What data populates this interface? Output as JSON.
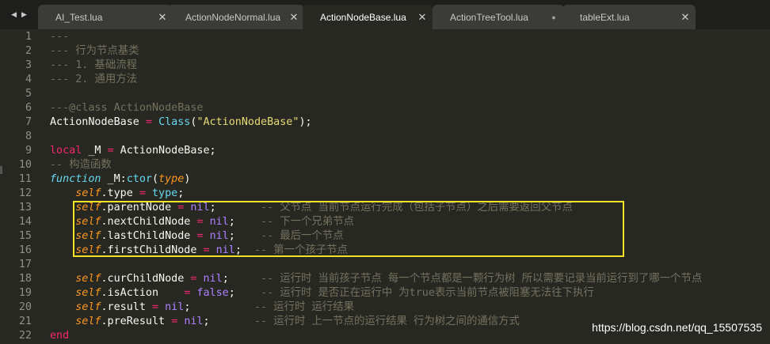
{
  "tabs": [
    {
      "label": "AI_Test.lua",
      "state": "close"
    },
    {
      "label": "ActionNodeNormal.lua",
      "state": "close"
    },
    {
      "label": "ActionNodeBase.lua",
      "state": "close",
      "active": true
    },
    {
      "label": "ActionTreeTool.lua",
      "state": "dirty"
    },
    {
      "label": "tableExt.lua",
      "state": "close"
    }
  ],
  "nav": {
    "back": "◀",
    "forward": "▶"
  },
  "lines": [
    {
      "n": "1",
      "parts": [
        [
          "cmt",
          "---"
        ]
      ]
    },
    {
      "n": "2",
      "parts": [
        [
          "cmt",
          "--- 行为节点基类"
        ]
      ]
    },
    {
      "n": "3",
      "parts": [
        [
          "cmt",
          "--- 1. 基础流程"
        ]
      ]
    },
    {
      "n": "4",
      "parts": [
        [
          "cmt",
          "--- 2. 通用方法"
        ]
      ]
    },
    {
      "n": "5",
      "parts": []
    },
    {
      "n": "6",
      "parts": [
        [
          "cmt",
          "---@class ActionNodeBase"
        ]
      ]
    },
    {
      "n": "7",
      "parts": [
        [
          "",
          "ActionNodeBase "
        ],
        [
          "op",
          "="
        ],
        [
          "",
          " "
        ],
        [
          "fn",
          "Class"
        ],
        [
          "",
          "("
        ],
        [
          "str",
          "\"ActionNodeBase\""
        ],
        [
          "",
          ");"
        ]
      ]
    },
    {
      "n": "8",
      "parts": []
    },
    {
      "n": "9",
      "parts": [
        [
          "kw",
          "local"
        ],
        [
          "",
          " _M "
        ],
        [
          "op",
          "="
        ],
        [
          "",
          " ActionNodeBase;"
        ]
      ]
    },
    {
      "n": "10",
      "parts": [
        [
          "cmt",
          "-- 构造函数"
        ]
      ]
    },
    {
      "n": "11",
      "parts": [
        [
          "kwi",
          "function"
        ],
        [
          "",
          " _M:"
        ],
        [
          "fn",
          "ctor"
        ],
        [
          "",
          "("
        ],
        [
          "param",
          "type"
        ],
        [
          "",
          ")"
        ]
      ]
    },
    {
      "n": "12",
      "parts": [
        [
          "",
          "    "
        ],
        [
          "self",
          "self"
        ],
        [
          "",
          ".type "
        ],
        [
          "op",
          "="
        ],
        [
          "",
          " "
        ],
        [
          "fn",
          "type"
        ],
        [
          "",
          ";"
        ]
      ]
    },
    {
      "n": "13",
      "parts": [
        [
          "",
          "    "
        ],
        [
          "self",
          "self"
        ],
        [
          "",
          ".parentNode "
        ],
        [
          "op",
          "="
        ],
        [
          "",
          " "
        ],
        [
          "num",
          "nil"
        ],
        [
          "",
          ";       "
        ],
        [
          "cmt",
          "-- 父节点 当前节点运行完成（包括子节点）之后需要返回父节点"
        ]
      ]
    },
    {
      "n": "14",
      "parts": [
        [
          "",
          "    "
        ],
        [
          "self",
          "self"
        ],
        [
          "",
          ".nextChildNode "
        ],
        [
          "op",
          "="
        ],
        [
          "",
          " "
        ],
        [
          "num",
          "nil"
        ],
        [
          "",
          ";    "
        ],
        [
          "cmt",
          "-- 下一个兄弟节点"
        ]
      ]
    },
    {
      "n": "15",
      "parts": [
        [
          "",
          "    "
        ],
        [
          "self",
          "self"
        ],
        [
          "",
          ".lastChildNode "
        ],
        [
          "op",
          "="
        ],
        [
          "",
          " "
        ],
        [
          "num",
          "nil"
        ],
        [
          "",
          ";    "
        ],
        [
          "cmt",
          "-- 最后一个节点"
        ]
      ]
    },
    {
      "n": "16",
      "parts": [
        [
          "",
          "    "
        ],
        [
          "self",
          "self"
        ],
        [
          "",
          ".firstChildNode "
        ],
        [
          "op",
          "="
        ],
        [
          "",
          " "
        ],
        [
          "num",
          "nil"
        ],
        [
          "",
          ";  "
        ],
        [
          "cmt",
          "-- 第一个孩子节点"
        ]
      ]
    },
    {
      "n": "17",
      "parts": []
    },
    {
      "n": "18",
      "parts": [
        [
          "",
          "    "
        ],
        [
          "self",
          "self"
        ],
        [
          "",
          ".curChildNode "
        ],
        [
          "op",
          "="
        ],
        [
          "",
          " "
        ],
        [
          "num",
          "nil"
        ],
        [
          "",
          ";     "
        ],
        [
          "cmt",
          "-- 运行时 当前孩子节点 每一个节点都是一颗行为树 所以需要记录当前运行到了哪一个节点"
        ]
      ]
    },
    {
      "n": "19",
      "parts": [
        [
          "",
          "    "
        ],
        [
          "self",
          "self"
        ],
        [
          "",
          ".isAction    "
        ],
        [
          "op",
          "="
        ],
        [
          "",
          " "
        ],
        [
          "num",
          "false"
        ],
        [
          "",
          ";    "
        ],
        [
          "cmt",
          "-- 运行时 是否正在运行中 为true表示当前节点被阻塞无法往下执行"
        ]
      ]
    },
    {
      "n": "20",
      "parts": [
        [
          "",
          "    "
        ],
        [
          "self",
          "self"
        ],
        [
          "",
          ".result "
        ],
        [
          "op",
          "="
        ],
        [
          "",
          " "
        ],
        [
          "num",
          "nil"
        ],
        [
          "",
          ";          "
        ],
        [
          "cmt",
          "-- 运行时 运行结果"
        ]
      ]
    },
    {
      "n": "21",
      "parts": [
        [
          "",
          "    "
        ],
        [
          "self",
          "self"
        ],
        [
          "",
          ".preResult "
        ],
        [
          "op",
          "="
        ],
        [
          "",
          " "
        ],
        [
          "num",
          "nil"
        ],
        [
          "",
          ";       "
        ],
        [
          "cmt",
          "-- 运行时 上一节点的运行结果 行为树之间的通信方式"
        ]
      ]
    },
    {
      "n": "22",
      "parts": [
        [
          "kw",
          "end"
        ]
      ]
    }
  ],
  "watermark": "https://blog.csdn.net/qq_15507535",
  "colors": {
    "background": "#272822",
    "comment": "#75715e",
    "keyword": "#f92672",
    "string": "#e6db74",
    "constant": "#ae81ff",
    "self": "#fd971f",
    "highlight_box": "#f3e22a"
  }
}
